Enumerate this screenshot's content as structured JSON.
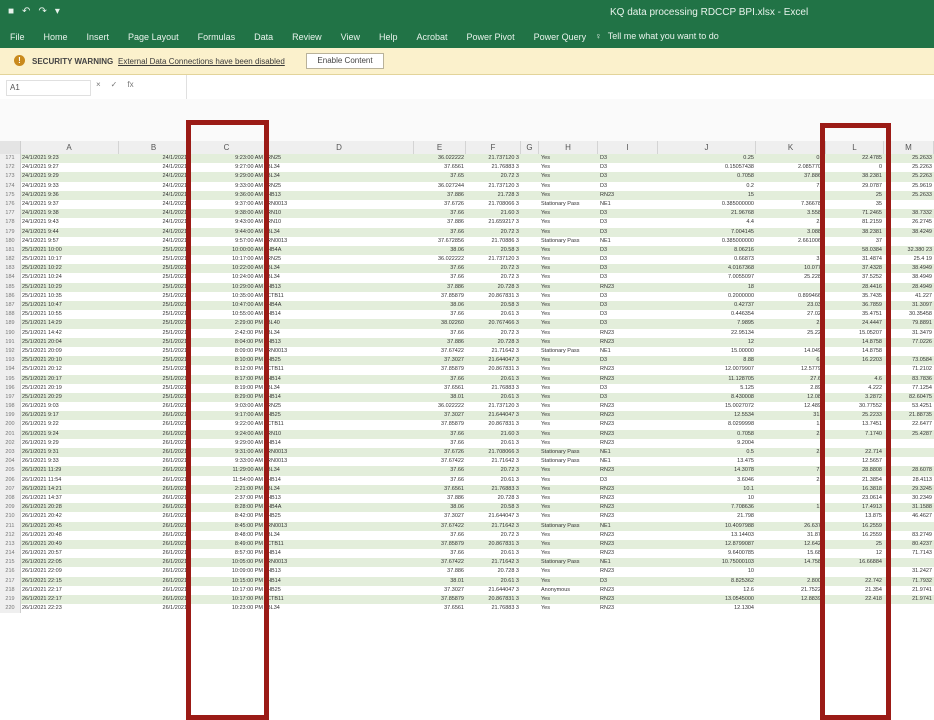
{
  "window": {
    "title": "KQ data processing RDCCP BPI.xlsx - Excel",
    "quick_access": [
      "save-icon",
      "undo-icon",
      "redo-icon",
      "customize-icon"
    ]
  },
  "ribbon": {
    "tabs": [
      "File",
      "Home",
      "Insert",
      "Page Layout",
      "Formulas",
      "Data",
      "Review",
      "View",
      "Help",
      "Acrobat",
      "Power Pivot",
      "Power Query"
    ],
    "tell_me": "Tell me what you want to do"
  },
  "security_bar": {
    "label": "SECURITY WARNING",
    "message": "External Data Connections have been disabled",
    "button": "Enable Content"
  },
  "formula_bar": {
    "name_box": "A1",
    "cancel": "×",
    "enter": "✓",
    "fx": "fx",
    "formula": ""
  },
  "grid": {
    "column_headers": [
      "A",
      "B",
      "C",
      "D",
      "E",
      "F",
      "G",
      "H",
      "I",
      "J",
      "K",
      "L",
      "M"
    ],
    "rows": [
      {
        "n": "171",
        "a": "24/1/2021 9:23",
        "b": "24/1/2021",
        "c": "9:23:00 AM",
        "d": "RN25",
        "e": "36.022222",
        "f": "21.737120 3",
        "g": "",
        "h": "Yes",
        "i": "D3",
        "j": "0.25",
        "k": "0.0",
        "l": "22.4785",
        "m": "25.2633"
      },
      {
        "n": "172",
        "a": "24/1/2021 9:27",
        "b": "24/1/2021",
        "c": "9:27:00 AM",
        "d": "BL34",
        "e": "37.6561",
        "f": "21.76883 3",
        "g": "",
        "h": "Yes",
        "i": "D3",
        "j": "0.15057438",
        "k": "2.0857708",
        "l": "0",
        "m": "25.2263"
      },
      {
        "n": "173",
        "a": "24/1/2021 9:29",
        "b": "24/1/2021",
        "c": "9:29:00 AM",
        "d": "BL34",
        "e": "37.65",
        "f": "20.72 3",
        "g": "",
        "h": "Yes",
        "i": "D3",
        "j": "0.7058",
        "k": "37.8863",
        "l": "38.2381",
        "m": "25.2263"
      },
      {
        "n": "174",
        "a": "24/1/2021 9:33",
        "b": "24/1/2021",
        "c": "9:33:00 AM",
        "d": "RN25",
        "e": "36.027244",
        "f": "21.737120 3",
        "g": "",
        "h": "Yes",
        "i": "D3",
        "j": "0.2",
        "k": "7.0",
        "l": "29.0787",
        "m": "25.9619"
      },
      {
        "n": "175",
        "a": "24/1/2021 9:36",
        "b": "24/1/2021",
        "c": "9:36:00 AM",
        "d": "HB13",
        "e": "37.886",
        "f": "21.728 3",
        "g": "",
        "h": "Yes",
        "i": "RN23",
        "j": "15",
        "k": "",
        "l": "25",
        "m": "25.2633"
      },
      {
        "n": "176",
        "a": "24/1/2021 9:37",
        "b": "24/1/2021",
        "c": "9:37:00 AM",
        "d": "RN0013",
        "e": "37.6726",
        "f": "21.708066 3",
        "g": "",
        "h": "Stationary Pass",
        "i": "NE1",
        "j": "0.385000000",
        "k": "7.366780",
        "l": "35",
        "m": ""
      },
      {
        "n": "177",
        "a": "24/1/2021 9:38",
        "b": "24/1/2021",
        "c": "9:38:00 AM",
        "d": "RN10",
        "e": "37.66",
        "f": "21.60 3",
        "g": "",
        "h": "Yes",
        "i": "D3",
        "j": "21.96768",
        "k": "3.5588",
        "l": "71.2465",
        "m": "38.7332"
      },
      {
        "n": "178",
        "a": "24/1/2021 9:43",
        "b": "24/1/2021",
        "c": "9:43:00 AM",
        "d": "RN10",
        "e": "37.886",
        "f": "21.659217 3",
        "g": "",
        "h": "Yes",
        "i": "D3",
        "j": "4.4",
        "k": "2.6",
        "l": "81.2159",
        "m": "26.2745"
      },
      {
        "n": "179",
        "a": "24/1/2021 9:44",
        "b": "24/1/2021",
        "c": "9:44:00 AM",
        "d": "BL34",
        "e": "37.66",
        "f": "20.72 3",
        "g": "",
        "h": "Yes",
        "i": "D3",
        "j": "7.004145",
        "k": "3.0882",
        "l": "38.2381",
        "m": "38.4249"
      },
      {
        "n": "180",
        "a": "24/1/2021 9:57",
        "b": "24/1/2021",
        "c": "9:57:00 AM",
        "d": "RN0013",
        "e": "37.672856",
        "f": "21.70886 3",
        "g": "",
        "h": "Stationary Pass",
        "i": "NE1",
        "j": "0.385000000",
        "k": "2.6610068",
        "l": "37",
        "m": ""
      },
      {
        "n": "181",
        "a": "25/1/2021 10:00",
        "b": "25/1/2021",
        "c": "10:00:00 AM",
        "d": "HB4A",
        "e": "38.06",
        "f": "20.58 3",
        "g": "",
        "h": "Yes",
        "i": "D3",
        "j": "8.06216",
        "k": "",
        "l": "58.0384",
        "m": "32.380 23"
      },
      {
        "n": "182",
        "a": "25/1/2021 10:17",
        "b": "25/1/2021",
        "c": "10:17:00 AM",
        "d": "RN25",
        "e": "36.022222",
        "f": "21.737120 3",
        "g": "",
        "h": "Yes",
        "i": "D3",
        "j": "0.66873",
        "k": "3.4",
        "l": "31.4874",
        "m": "25.4 19"
      },
      {
        "n": "183",
        "a": "25/1/2021 10:22",
        "b": "25/1/2021",
        "c": "10:22:00 AM",
        "d": "BL34",
        "e": "37.66",
        "f": "20.72 3",
        "g": "",
        "h": "Yes",
        "i": "D3",
        "j": "4.0167368",
        "k": "10.0778",
        "l": "37.4328",
        "m": "38.4949"
      },
      {
        "n": "184",
        "a": "25/1/2021 10:24",
        "b": "25/1/2021",
        "c": "10:24:00 AM",
        "d": "BL34",
        "e": "37.66",
        "f": "20.72 3",
        "g": "",
        "h": "Yes",
        "i": "D3",
        "j": "7.0055097",
        "k": "25.2288",
        "l": "37.5252",
        "m": "38.4949"
      },
      {
        "n": "185",
        "a": "25/1/2021 10:29",
        "b": "25/1/2021",
        "c": "10:29:00 AM",
        "d": "HB13",
        "e": "37.886",
        "f": "20.728 3",
        "g": "",
        "h": "Yes",
        "i": "RN23",
        "j": "18",
        "k": "",
        "l": "28.4416",
        "m": "28.4949"
      },
      {
        "n": "186",
        "a": "25/1/2021 10:35",
        "b": "25/1/2021",
        "c": "10:35:00 AM",
        "d": "CTB11",
        "e": "37.85879",
        "f": "20.867831 3",
        "g": "",
        "h": "Yes",
        "i": "D3",
        "j": "0.2000000",
        "k": "0.8994663",
        "l": "35.7435",
        "m": "41.227"
      },
      {
        "n": "187",
        "a": "25/1/2021 10:47",
        "b": "25/1/2021",
        "c": "10:47:00 AM",
        "d": "HB4A",
        "e": "38.06",
        "f": "20.58 3",
        "g": "",
        "h": "Yes",
        "i": "D3",
        "j": "0.42737",
        "k": "23.034",
        "l": "36.7859",
        "m": "31.3097"
      },
      {
        "n": "188",
        "a": "25/1/2021 10:55",
        "b": "25/1/2021",
        "c": "10:55:00 AM",
        "d": "HB14",
        "e": "37.66",
        "f": "20.61 3",
        "g": "",
        "h": "Yes",
        "i": "D3",
        "j": "0.446354",
        "k": "27.024",
        "l": "35.4751",
        "m": "30.35458"
      },
      {
        "n": "189",
        "a": "25/1/2021 14:29",
        "b": "25/1/2021",
        "c": "2:29:00 PM",
        "d": "BL40",
        "e": "38.02260",
        "f": "20.767466 3",
        "g": "",
        "h": "Yes",
        "i": "D3",
        "j": "7.9895",
        "k": "2.8",
        "l": "24.4447",
        "m": "79.8891"
      },
      {
        "n": "190",
        "a": "25/1/2021 14:42",
        "b": "25/1/2021",
        "c": "2:42:00 PM",
        "d": "BL34",
        "e": "37.66",
        "f": "20.72 3",
        "g": "",
        "h": "Yes",
        "i": "RN23",
        "j": "22.95134",
        "k": "25.225",
        "l": "15.05207",
        "m": "31.3479"
      },
      {
        "n": "191",
        "a": "25/1/2021 20:04",
        "b": "25/1/2021",
        "c": "8:04:00 PM",
        "d": "HB13",
        "e": "37.886",
        "f": "20.728 3",
        "g": "",
        "h": "Yes",
        "i": "RN23",
        "j": "12",
        "k": "",
        "l": "14.8758",
        "m": "77.0226"
      },
      {
        "n": "192",
        "a": "25/1/2021 20:09",
        "b": "25/1/2021",
        "c": "8:09:00 PM",
        "d": "RN0013",
        "e": "37.67422",
        "f": "21.71642 3",
        "g": "",
        "h": "Stationary Pass",
        "i": "NE1",
        "j": "15.00000",
        "k": "14.0494",
        "l": "14.8758",
        "m": ""
      },
      {
        "n": "193",
        "a": "25/1/2021 20:10",
        "b": "25/1/2021",
        "c": "8:10:00 PM",
        "d": "HB25",
        "e": "37.3027",
        "f": "21.644047 3",
        "g": "",
        "h": "Yes",
        "i": "D3",
        "j": "8.88",
        "k": "6.7",
        "l": "16.2203",
        "m": "73.0584"
      },
      {
        "n": "194",
        "a": "25/1/2021 20:12",
        "b": "25/1/2021",
        "c": "8:12:00 PM",
        "d": "CTB11",
        "e": "37.85879",
        "f": "20.867831 3",
        "g": "",
        "h": "Yes",
        "i": "RN23",
        "j": "12.0079907",
        "k": "12.57795",
        "l": "",
        "m": "71.2102"
      },
      {
        "n": "195",
        "a": "25/1/2021 20:17",
        "b": "25/1/2021",
        "c": "8:17:00 PM",
        "d": "HB14",
        "e": "37.66",
        "f": "20.61 3",
        "g": "",
        "h": "Yes",
        "i": "RN23",
        "j": "11.128705",
        "k": "27.66",
        "l": "4.6",
        "m": "83.7836"
      },
      {
        "n": "196",
        "a": "25/1/2021 20:19",
        "b": "25/1/2021",
        "c": "8:19:00 PM",
        "d": "BL34",
        "e": "37.6561",
        "f": "21.76883 3",
        "g": "",
        "h": "Yes",
        "i": "D3",
        "j": "5.125",
        "k": "2.895",
        "l": "4.222",
        "m": "77.1254"
      },
      {
        "n": "197",
        "a": "25/1/2021 20:29",
        "b": "25/1/2021",
        "c": "8:29:00 PM",
        "d": "HB14",
        "e": "38.01",
        "f": "20.61 3",
        "g": "",
        "h": "Yes",
        "i": "D3",
        "j": "8.430008",
        "k": "12.088",
        "l": "3.2872",
        "m": "82.60475"
      },
      {
        "n": "198",
        "a": "26/1/2021 9:03",
        "b": "26/1/2021",
        "c": "9:03:00 AM",
        "d": "RN25",
        "e": "36.022222",
        "f": "21.737120 3",
        "g": "",
        "h": "Yes",
        "i": "RN23",
        "j": "15.0027072",
        "k": "12.4894",
        "l": "30.77552",
        "m": "53.4251"
      },
      {
        "n": "199",
        "a": "26/1/2021 9:17",
        "b": "26/1/2021",
        "c": "9:17:00 AM",
        "d": "HB25",
        "e": "37.3027",
        "f": "21.644047 3",
        "g": "",
        "h": "Yes",
        "i": "RN23",
        "j": "12.5534",
        "k": "31.5",
        "l": "25.2233",
        "m": "21.88735"
      },
      {
        "n": "200",
        "a": "26/1/2021 9:22",
        "b": "26/1/2021",
        "c": "9:22:00 AM",
        "d": "CTB11",
        "e": "37.85879",
        "f": "20.867831 3",
        "g": "",
        "h": "Yes",
        "i": "RN23",
        "j": "8.0299998",
        "k": "1.3",
        "l": "13.7451",
        "m": "22.6477"
      },
      {
        "n": "201",
        "a": "26/1/2021 9:24",
        "b": "26/1/2021",
        "c": "9:24:00 AM",
        "d": "RN10",
        "e": "37.66",
        "f": "21.60 3",
        "g": "",
        "h": "Yes",
        "i": "RN23",
        "j": "0.7058",
        "k": "2.2",
        "l": "7.1740",
        "m": "25.4287"
      },
      {
        "n": "202",
        "a": "26/1/2021 9:29",
        "b": "26/1/2021",
        "c": "9:29:00 AM",
        "d": "HB14",
        "e": "37.66",
        "f": "20.61 3",
        "g": "",
        "h": "Yes",
        "i": "RN23",
        "j": "9.2004",
        "k": "",
        "l": "",
        "m": ""
      },
      {
        "n": "203",
        "a": "26/1/2021 9:31",
        "b": "26/1/2021",
        "c": "9:31:00 AM",
        "d": "RN0013",
        "e": "37.6726",
        "f": "21.708066 3",
        "g": "",
        "h": "Stationary Pass",
        "i": "NE1",
        "j": "0.5",
        "k": "2.1",
        "l": "22.714",
        "m": ""
      },
      {
        "n": "204",
        "a": "26/1/2021 9:33",
        "b": "26/1/2021",
        "c": "9:33:00 AM",
        "d": "RN0013",
        "e": "37.67422",
        "f": "21.71642 3",
        "g": "",
        "h": "Stationary Pass",
        "i": "NE1",
        "j": "13.475",
        "k": "",
        "l": "12.5657",
        "m": ""
      },
      {
        "n": "205",
        "a": "26/1/2021 11:29",
        "b": "26/1/2021",
        "c": "11:29:00 AM",
        "d": "BL34",
        "e": "37.66",
        "f": "20.72 3",
        "g": "",
        "h": "Yes",
        "i": "RN23",
        "j": "14.3078",
        "k": "7.2",
        "l": "28.8808",
        "m": "28.6078"
      },
      {
        "n": "206",
        "a": "26/1/2021 11:54",
        "b": "26/1/2021",
        "c": "11:54:00 AM",
        "d": "HB14",
        "e": "37.66",
        "f": "20.61 3",
        "g": "",
        "h": "Yes",
        "i": "D3",
        "j": "3.6046",
        "k": "2.8",
        "l": "21.3854",
        "m": "28.4113"
      },
      {
        "n": "207",
        "a": "26/1/2021 14:21",
        "b": "26/1/2021",
        "c": "2:21:00 PM",
        "d": "BL34",
        "e": "37.6561",
        "f": "21.76883 3",
        "g": "",
        "h": "Yes",
        "i": "RN23",
        "j": "10.1",
        "k": "",
        "l": "16.3818",
        "m": "29.3245"
      },
      {
        "n": "208",
        "a": "26/1/2021 14:37",
        "b": "26/1/2021",
        "c": "2:37:00 PM",
        "d": "HB13",
        "e": "37.886",
        "f": "20.728 3",
        "g": "",
        "h": "Yes",
        "i": "RN23",
        "j": "10",
        "k": "",
        "l": "23.0614",
        "m": "30.2349"
      },
      {
        "n": "209",
        "a": "26/1/2021 20:28",
        "b": "26/1/2021",
        "c": "8:28:00 PM",
        "d": "HB4A",
        "e": "38.06",
        "f": "20.58 3",
        "g": "",
        "h": "Yes",
        "i": "RN23",
        "j": "7.708636",
        "k": "1.4",
        "l": "17.4913",
        "m": "31.1588"
      },
      {
        "n": "210",
        "a": "26/1/2021 20:42",
        "b": "26/1/2021",
        "c": "8:42:00 PM",
        "d": "HB25",
        "e": "37.3027",
        "f": "21.644047 3",
        "g": "",
        "h": "Yes",
        "i": "RN23",
        "j": "21.798",
        "k": "",
        "l": "13.875",
        "m": "46.4627"
      },
      {
        "n": "211",
        "a": "26/1/2021 20:45",
        "b": "26/1/2021",
        "c": "8:45:00 PM",
        "d": "RN0013",
        "e": "37.67422",
        "f": "21.71642 3",
        "g": "",
        "h": "Stationary Pass",
        "i": "NE1",
        "j": "10.4097988",
        "k": "26.6379",
        "l": "16.2559",
        "m": ""
      },
      {
        "n": "212",
        "a": "26/1/2021 20:48",
        "b": "26/1/2021",
        "c": "8:48:00 PM",
        "d": "BL34",
        "e": "37.66",
        "f": "20.72 3",
        "g": "",
        "h": "Yes",
        "i": "RN23",
        "j": "13.14403",
        "k": "31.872",
        "l": "16.2559",
        "m": "83.2749"
      },
      {
        "n": "213",
        "a": "26/1/2021 20:49",
        "b": "26/1/2021",
        "c": "8:49:00 PM",
        "d": "CTB11",
        "e": "37.85879",
        "f": "20.867831 3",
        "g": "",
        "h": "Yes",
        "i": "RN23",
        "j": "12.8799087",
        "k": "12.6423",
        "l": "25",
        "m": "80.4237"
      },
      {
        "n": "214",
        "a": "26/1/2021 20:57",
        "b": "26/1/2021",
        "c": "8:57:00 PM",
        "d": "HB14",
        "e": "37.66",
        "f": "20.61 3",
        "g": "",
        "h": "Yes",
        "i": "RN23",
        "j": "9.6400785",
        "k": "15.685",
        "l": "12",
        "m": "71.7143"
      },
      {
        "n": "215",
        "a": "26/1/2021 22:05",
        "b": "26/1/2021",
        "c": "10:05:00 PM",
        "d": "RN0013",
        "e": "37.67422",
        "f": "21.71642 3",
        "g": "",
        "h": "Stationary Pass",
        "i": "NE1",
        "j": "10.75000103",
        "k": "14.7584",
        "l": "16.66884",
        "m": ""
      },
      {
        "n": "216",
        "a": "26/1/2021 22:09",
        "b": "26/1/2021",
        "c": "10:09:00 PM",
        "d": "HB13",
        "e": "37.886",
        "f": "20.728 3",
        "g": "",
        "h": "Yes",
        "i": "RN23",
        "j": "10",
        "k": "",
        "l": "",
        "m": "31.2427"
      },
      {
        "n": "217",
        "a": "26/1/2021 22:15",
        "b": "26/1/2021",
        "c": "10:15:00 PM",
        "d": "HB14",
        "e": "38.01",
        "f": "20.61 3",
        "g": "",
        "h": "Yes",
        "i": "D3",
        "j": "8.825362",
        "k": "2.8008",
        "l": "22.742",
        "m": "71.7932"
      },
      {
        "n": "218",
        "a": "26/1/2021 22:17",
        "b": "26/1/2021",
        "c": "10:17:00 PM",
        "d": "HB25",
        "e": "37.3027",
        "f": "21.644047 3",
        "g": "",
        "h": "Anonymous",
        "i": "RN23",
        "j": "12.6",
        "k": "21.75225",
        "l": "21.354",
        "m": "21.9741"
      },
      {
        "n": "219",
        "a": "26/1/2021 22:17",
        "b": "26/1/2021",
        "c": "10:17:00 PM",
        "d": "CTB11",
        "e": "37.85879",
        "f": "20.867831 3",
        "g": "",
        "h": "Yes",
        "i": "RN23",
        "j": "13.0545000",
        "k": "12.88398",
        "l": "22.418",
        "m": "21.9741"
      },
      {
        "n": "220",
        "a": "26/1/2021 22:23",
        "b": "26/1/2021",
        "c": "10:23:00 PM",
        "d": "BL34",
        "e": "37.6561",
        "f": "21.76883 3",
        "g": "",
        "h": "Yes",
        "i": "RN23",
        "j": "12.1304",
        "k": "",
        "l": "",
        "m": ""
      }
    ]
  }
}
